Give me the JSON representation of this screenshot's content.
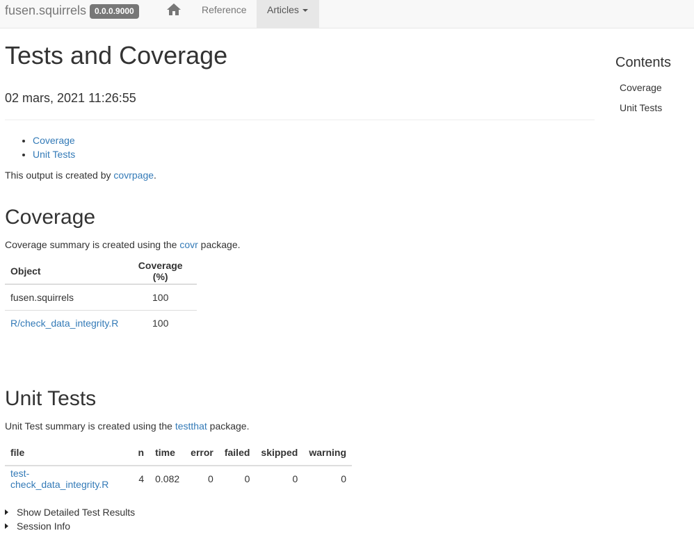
{
  "navbar": {
    "brand": "fusen.squirrels",
    "version": "0.0.0.9000",
    "home_icon": "home-icon",
    "reference_label": "Reference",
    "articles_label": "Articles"
  },
  "page": {
    "title": "Tests and Coverage",
    "date": "02 mars, 2021 11:26:55",
    "toc": [
      "Coverage",
      "Unit Tests"
    ],
    "intro_prefix": "This output is created by ",
    "intro_link": "covrpage",
    "intro_suffix": "."
  },
  "coverage": {
    "heading": "Coverage",
    "desc_prefix": "Coverage summary is created using the ",
    "desc_link": "covr",
    "desc_suffix": " package.",
    "columns": [
      "Object",
      "Coverage (%)"
    ],
    "rows": [
      {
        "object": "fusen.squirrels",
        "coverage": "100"
      },
      {
        "object": "R/check_data_integrity.R",
        "coverage": "100"
      }
    ]
  },
  "unit_tests": {
    "heading": "Unit Tests",
    "desc_prefix": "Unit Test summary is created using the ",
    "desc_link": "testthat",
    "desc_suffix": " package.",
    "columns": [
      "file",
      "n",
      "time",
      "error",
      "failed",
      "skipped",
      "warning"
    ],
    "rows": [
      {
        "file": "test-check_data_integrity.R",
        "n": "4",
        "time": "0.082",
        "error": "0",
        "failed": "0",
        "skipped": "0",
        "warning": "0"
      }
    ],
    "details": [
      "Show Detailed Test Results",
      "Session Info"
    ]
  },
  "sidebar": {
    "title": "Contents",
    "links": [
      "Coverage",
      "Unit Tests"
    ]
  }
}
